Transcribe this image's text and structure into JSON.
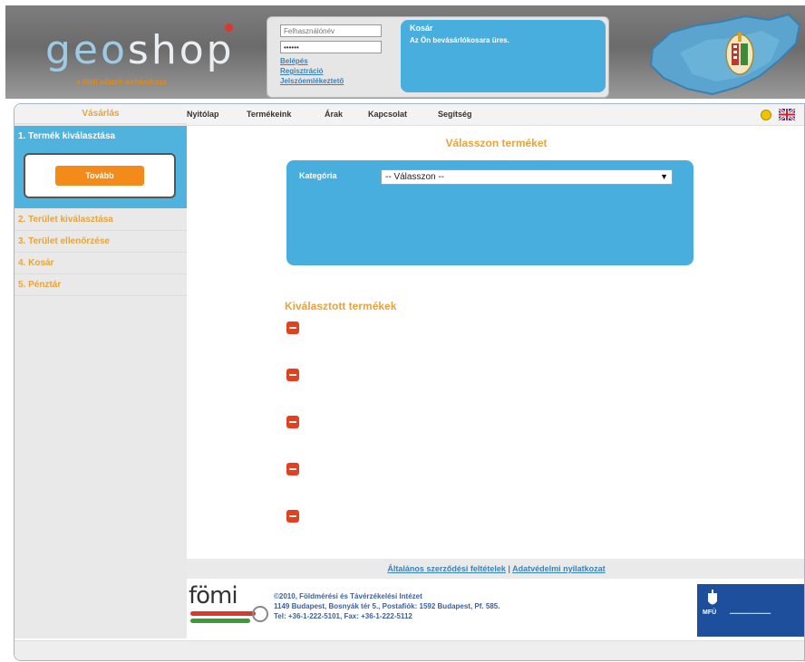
{
  "header": {
    "logo_part1": "geo",
    "logo_part2": "shop",
    "tagline": "a földi adatok webáruháza",
    "login": {
      "username_placeholder": "Felhasználónév",
      "password_value": "••••••",
      "links": [
        "Belépés",
        "Regisztráció",
        "Jelszóemlékeztető"
      ]
    },
    "cart": {
      "title": "Kosár",
      "text": "Az Ön bevásárlókosara üres."
    }
  },
  "sidebar": {
    "section_title": "Vásárlás",
    "active_step": "1. Termék kiválasztása",
    "next_button": "Tovább",
    "steps": [
      "2. Terület kiválasztása",
      "3. Terület ellenőrzése",
      "4. Kosár",
      "5. Pénztár"
    ]
  },
  "nav": {
    "items": [
      "Nyitólap",
      "Termékeink",
      "Árak",
      "Kapcsolat",
      "Segítség"
    ]
  },
  "content": {
    "title": "Válasszon terméket",
    "category_label": "Kategória",
    "category_value": "-- Válasszon --",
    "selected_title": "Kiválasztott termékek"
  },
  "links": {
    "terms": "Általános szerződési feltételek",
    "separator": "|",
    "privacy": "Adatvédelmi nyilatkozat"
  },
  "footer": {
    "logo_text": "fömi",
    "line1": "©2010, Földmérési és Távérzékelési Intézet",
    "line2": "1149 Budapest, Bosnyák tér 5., Postafiók: 1592 Budapest, Pf. 585.",
    "line3": "Tel: +36-1-222-5101, Fax: +36-1-222-5112",
    "partner_mark": "MFÜ"
  },
  "colors": {
    "accent_orange": "#e8a43a",
    "accent_blue": "#47aedd",
    "button_orange": "#f38a1a",
    "remove_red": "#e2401f"
  }
}
